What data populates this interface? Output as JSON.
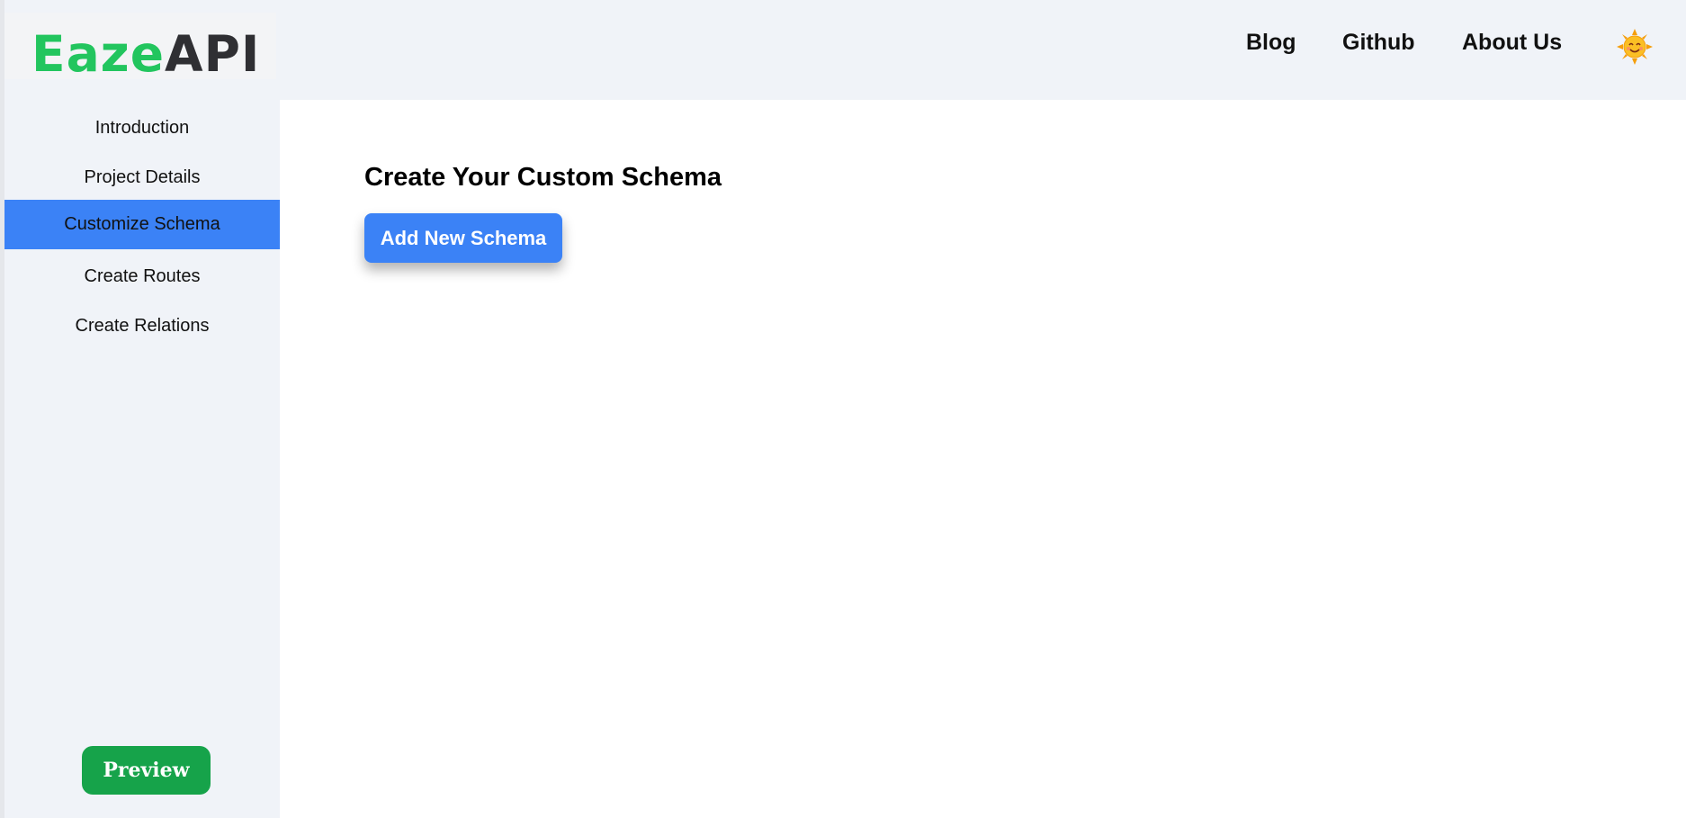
{
  "header": {
    "logo": {
      "part1": "Eaze",
      "part2": "API"
    },
    "nav": [
      {
        "label": "Blog"
      },
      {
        "label": "Github"
      },
      {
        "label": "About Us"
      }
    ],
    "theme_toggle_icon": "smiling-sun-icon"
  },
  "sidebar": {
    "items": [
      {
        "label": "Introduction",
        "active": false
      },
      {
        "label": "Project Details",
        "active": false
      },
      {
        "label": "Customize Schema",
        "active": true
      },
      {
        "label": "Create Routes",
        "active": false
      },
      {
        "label": "Create Relations",
        "active": false
      }
    ],
    "preview_label": "Preview"
  },
  "main": {
    "title": "Create Your Custom Schema",
    "add_button_label": "Add New Schema"
  },
  "colors": {
    "brand_green": "#22c55e",
    "accent_blue": "#3b82f6",
    "preview_green": "#16a34a",
    "panel_bg": "#f0f3f8"
  }
}
